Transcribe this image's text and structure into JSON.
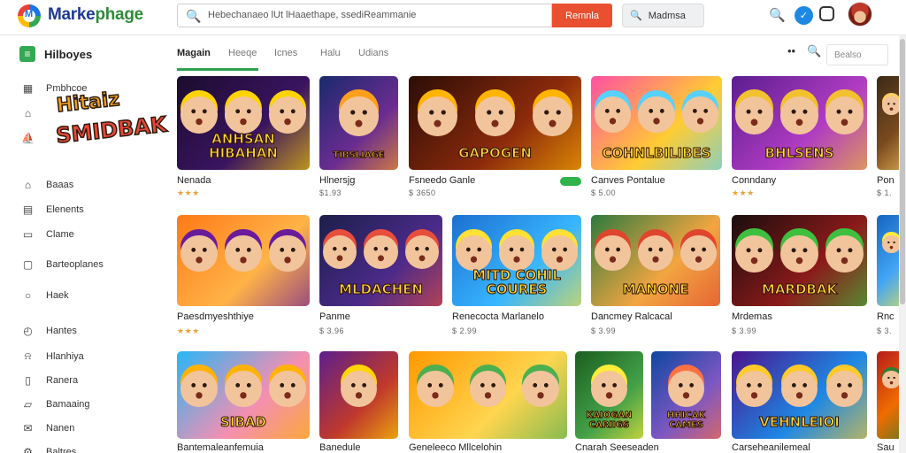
{
  "header": {
    "brand_left": "Marke",
    "brand_right": "phage",
    "search_text": "Hebechanaeo lUt lHaaethape, ssediReammanie",
    "search_button": "Remnla",
    "pill_label": "Madmsa",
    "icons": [
      "search-icon",
      "notification-icon",
      "chat-icon"
    ]
  },
  "sidebar": {
    "title": "Hilboyes",
    "sticker_top": "Hitaiz",
    "sticker_bottom": "SMIDBAK",
    "items": [
      {
        "label": "Pmbhcoe",
        "icon": "calendar-icon"
      },
      {
        "label": "",
        "icon": "home-icon"
      },
      {
        "label": "",
        "icon": "cart-icon"
      },
      {
        "label": "Baaas",
        "icon": "home-icon"
      },
      {
        "label": "Elenents",
        "icon": "grid-icon"
      },
      {
        "label": "Clame",
        "icon": "card-icon"
      },
      {
        "label": "Barteoplanes",
        "icon": "window-icon"
      },
      {
        "label": "Haek",
        "icon": "circle-icon"
      },
      {
        "label": "Hantes",
        "icon": "clock-icon"
      },
      {
        "label": "Hlanhiya",
        "icon": "bell-icon"
      },
      {
        "label": "Ranera",
        "icon": "page-icon"
      },
      {
        "label": "Bamaaing",
        "icon": "folder-icon"
      },
      {
        "label": "Nanen",
        "icon": "mail-icon"
      },
      {
        "label": "Baltres",
        "icon": "gear-icon"
      }
    ]
  },
  "tabs": {
    "items": [
      "Magain",
      "Heeqe",
      "Icnes",
      "Halu",
      "Udians"
    ],
    "sort_label": "Bealso"
  },
  "cards": [
    {
      "name": "Nenada",
      "meta": "★★★",
      "art": "ANHSAN HIBAHAN",
      "colors": [
        "#1b0c2e",
        "#3a1460",
        "#ffd400"
      ]
    },
    {
      "name": "Hlnersjg",
      "meta": "$1.93",
      "art": "TIBSLIAGE",
      "colors": [
        "#1a2a6c",
        "#6a2c91",
        "#ff9f1c"
      ]
    },
    {
      "name": "Fsneedo Ganle",
      "meta": "$ 3650",
      "art": "GAPOGEN",
      "colors": [
        "#2b0d06",
        "#8c2a0c",
        "#ffb400"
      ]
    },
    {
      "name": "Canves Pontalue",
      "meta": "$ 5.00",
      "art": "COHNLBILIBES",
      "colors": [
        "#ff4fa3",
        "#ffcc33",
        "#57d1ff"
      ]
    },
    {
      "name": "Conndany",
      "meta": "★★★",
      "art": "BHLSENS",
      "colors": [
        "#5b1d8f",
        "#b03cc3",
        "#f2c12e"
      ]
    },
    {
      "name": "Pon",
      "meta": "$ 1.",
      "art": "",
      "colors": [
        "#3b2a18",
        "#7a4a1e",
        "#ffcc66"
      ]
    },
    {
      "name": "Paesdmyeshthiye",
      "meta": "★★★",
      "art": "",
      "colors": [
        "#ff7a18",
        "#ffb347",
        "#6a1b9a"
      ]
    },
    {
      "name": "Panme",
      "meta": "$ 3.96",
      "art": "MLDACHEN",
      "colors": [
        "#1b1f4a",
        "#4b2a8a",
        "#e84e3c"
      ]
    },
    {
      "name": "Renecocta Marlanelo",
      "meta": "$ 2.99",
      "art": "MITD COHIL COURES",
      "colors": [
        "#1c6fd1",
        "#38b6ff",
        "#ffe135"
      ]
    },
    {
      "name": "Dancmey Ralcacal",
      "meta": "$ 3.99",
      "art": "MANONE",
      "colors": [
        "#2d7a3e",
        "#f2a541",
        "#e0452e"
      ]
    },
    {
      "name": "Mrdemas",
      "meta": "$ 3.99",
      "art": "MARDBAK",
      "colors": [
        "#1a0d0d",
        "#8b1a1a",
        "#3fbf3f"
      ]
    },
    {
      "name": "Rnc",
      "meta": "$ 3.",
      "art": "",
      "colors": [
        "#1565c0",
        "#42a5f5",
        "#ffeb3b"
      ]
    },
    {
      "name": "Bantemaleanfemuia",
      "meta": "",
      "art": "SIBAD",
      "colors": [
        "#29b6f6",
        "#f48fb1",
        "#ffb300"
      ]
    },
    {
      "name": "Banedule",
      "meta": "",
      "art": "",
      "colors": [
        "#5d1f8c",
        "#c0392b",
        "#ffd600"
      ]
    },
    {
      "name": "Geneleeco Mllcelohin",
      "meta": "",
      "art": "",
      "colors": [
        "#ff9800",
        "#ffd54f",
        "#4caf50"
      ]
    },
    {
      "name": "Cnarah Seeseaden",
      "meta": "",
      "art": "KAIOGAN CARIIGS",
      "colors": [
        "#1b5e20",
        "#43a047",
        "#ffeb3b"
      ]
    },
    {
      "name": "",
      "meta": "",
      "art": "HHICAK CAMES",
      "colors": [
        "#0d47a1",
        "#7e57c2",
        "#ff7043"
      ]
    },
    {
      "name": "Carseheanilemeal",
      "meta": "",
      "art": "VEHNLEIOI",
      "colors": [
        "#4a148c",
        "#1e88e5",
        "#ffca28"
      ]
    },
    {
      "name": "Sau",
      "meta": "",
      "art": "",
      "colors": [
        "#b71c1c",
        "#ef6c00",
        "#2e7d32"
      ]
    }
  ]
}
